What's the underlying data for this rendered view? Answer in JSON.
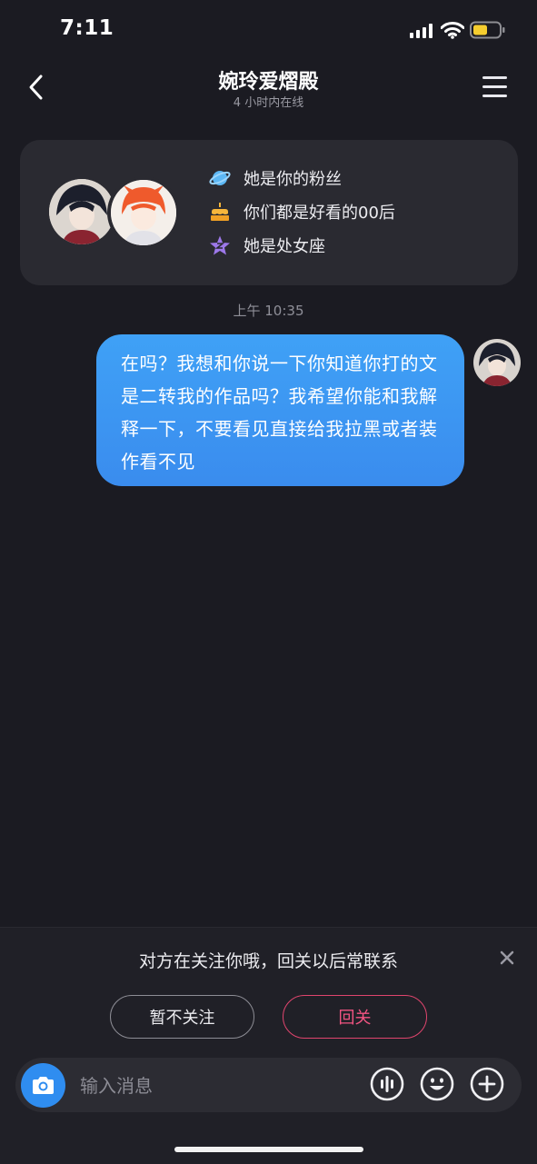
{
  "status_bar": {
    "time": "7:11"
  },
  "header": {
    "title": "婉玲爱熠殿",
    "subtitle": "4 小时内在线"
  },
  "info_card": {
    "items": [
      {
        "icon": "planet-icon",
        "text": "她是你的粉丝"
      },
      {
        "icon": "cake-icon",
        "text": "你们都是好看的00后"
      },
      {
        "icon": "star-icon",
        "text": "她是处女座"
      }
    ]
  },
  "chat": {
    "timestamp": "上午 10:35",
    "messages": [
      {
        "sender": "me",
        "text": "在吗？我想和你说一下你知道你打的文是二转我的作品吗？我希望你能和我解释一下，不要看见直接给我拉黑或者装作看不见"
      }
    ]
  },
  "follow_prompt": {
    "text": "对方在关注你哦，回关以后常联系",
    "skip_label": "暂不关注",
    "follow_label": "回关"
  },
  "input_bar": {
    "placeholder": "输入消息"
  },
  "colors": {
    "background": "#1b1b22",
    "bubble": "#3a8cee",
    "accent_pink": "#f25482",
    "camera_blue": "#2f8df0"
  }
}
